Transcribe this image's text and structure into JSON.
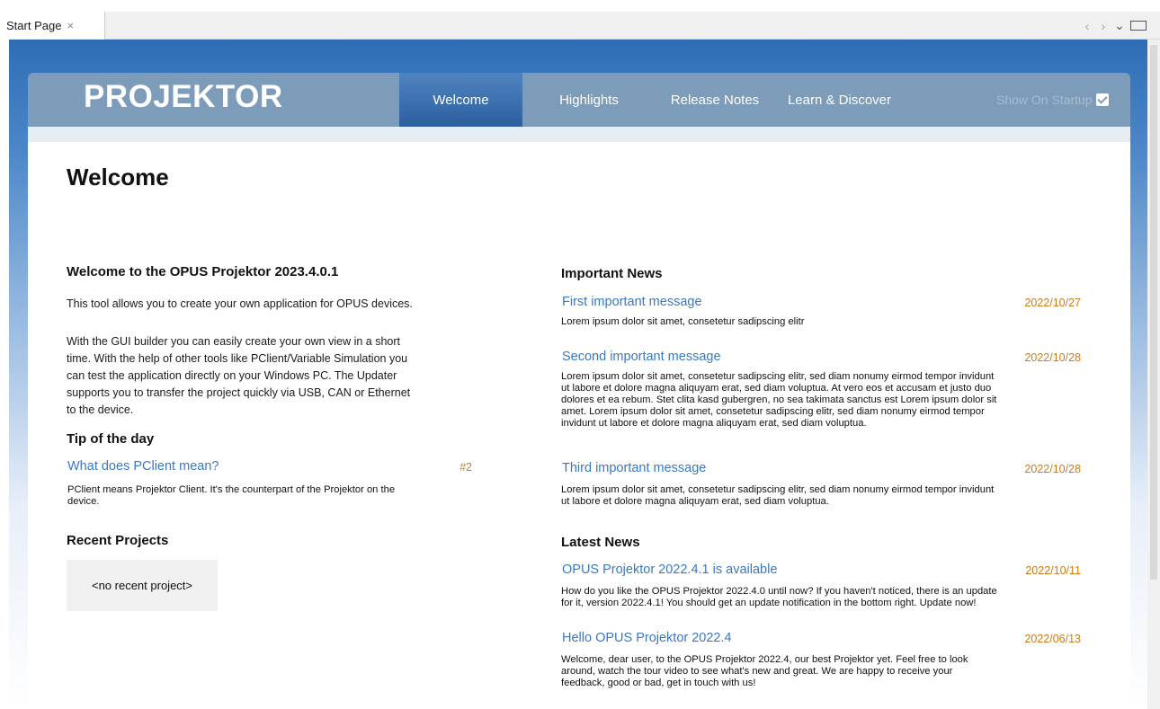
{
  "tab": {
    "label": "Start Page",
    "close": "×"
  },
  "window_controls": {
    "back": "‹",
    "forward": "›",
    "menu": "⌄"
  },
  "header": {
    "logo": "PROJEKTOR",
    "nav": [
      {
        "label": "Welcome",
        "active": true
      },
      {
        "label": "Highlights"
      },
      {
        "label": "Release Notes"
      },
      {
        "label": "Learn & Discover"
      }
    ],
    "show_on_startup": "Show On Startup",
    "show_on_startup_checked": true
  },
  "page_title": "Welcome",
  "left": {
    "intro_heading": "Welcome to the OPUS Projektor 2023.4.0.1",
    "intro_p1": "This tool allows you to create your own application for OPUS devices.",
    "intro_p2_lines": [
      "With the GUI builder you can easily create your own view in a short",
      "time. With the help of other tools like PClient/Variable Simulation you",
      "can test the application directly on your Windows PC. The Updater",
      "supports you to transfer the project quickly via USB, CAN or Ethernet",
      "to the device."
    ],
    "tip_heading": "Tip of the day",
    "tip_title": "What does PClient mean?",
    "tip_number": "#2",
    "tip_lines": [
      "PClient means Projektor Client. It's the counterpart of the Projektor on the",
      "device."
    ],
    "recent_heading": "Recent Projects",
    "recent_empty": "<no recent project>"
  },
  "right": {
    "important_heading": "Important News",
    "important": [
      {
        "title": "First important message",
        "date": "2022/10/27",
        "lines": [
          "Lorem ipsum dolor sit amet, consetetur sadipscing elitr"
        ]
      },
      {
        "title": "Second important message",
        "date": "2022/10/28",
        "lines": [
          "Lorem ipsum dolor sit amet, consetetur sadipscing elitr, sed diam nonumy eirmod tempor invidunt",
          "ut labore et dolore magna aliquyam erat, sed diam voluptua. At vero eos et accusam et justo duo",
          "dolores et ea rebum. Stet clita kasd gubergren, no sea takimata sanctus est Lorem ipsum dolor sit",
          "amet. Lorem ipsum dolor sit amet, consetetur sadipscing elitr, sed diam nonumy eirmod tempor",
          "invidunt ut labore et dolore magna aliquyam erat, sed diam voluptua."
        ]
      },
      {
        "title": "Third important message",
        "date": "2022/10/28",
        "lines": [
          "Lorem ipsum dolor sit amet, consetetur sadipscing elitr, sed diam nonumy eirmod tempor invidunt",
          "ut labore et dolore magna aliquyam erat, sed diam voluptua."
        ]
      }
    ],
    "latest_heading": "Latest News",
    "latest": [
      {
        "title": "OPUS Projektor 2022.4.1 is available",
        "date": "2022/10/11",
        "lines": [
          "How do you like the OPUS Projektor 2022.4.0 until now? If you haven't noticed, there is an update",
          "for it, version 2022.4.1! You should get an update notification in the bottom right. Update now!"
        ]
      },
      {
        "title": "Hello OPUS Projektor 2022.4",
        "date": "2022/06/13",
        "lines": [
          "Welcome, dear user, to the OPUS Projektor 2022.4, our best Projektor yet. Feel free to look",
          "around, watch the tour video to see what's new and great. We are happy to receive your",
          "feedback, good or bad, get in touch with us!"
        ]
      }
    ]
  },
  "colors": {
    "accent_link": "#3a78c2",
    "date": "#d07a17",
    "header_bg": "#7d9cb9",
    "nav_active": "#2d5f9f",
    "background_blue": "#2e6db5"
  }
}
